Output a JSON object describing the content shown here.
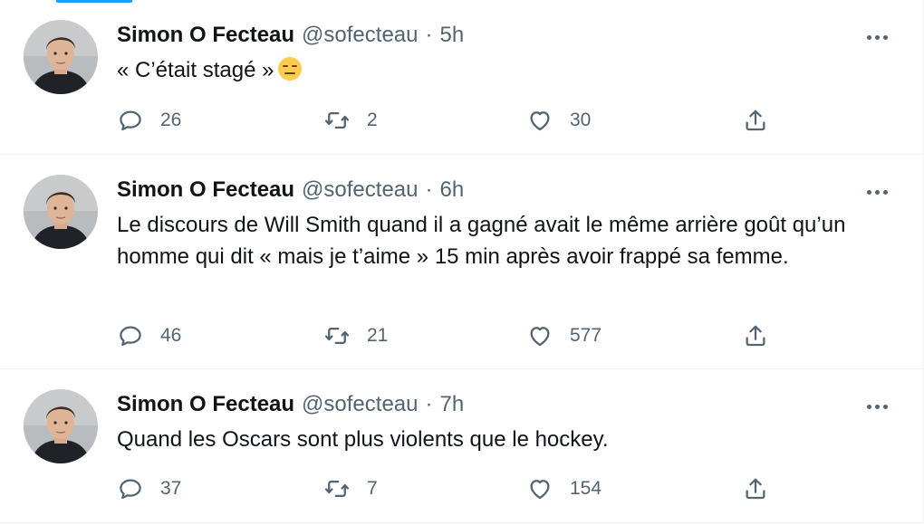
{
  "colors": {
    "accent": "#1d9bf0",
    "text": "#0f1419",
    "secondary": "#536471",
    "border": "#eff3f4"
  },
  "tweets": [
    {
      "display_name": "Simon O Fecteau",
      "handle": "@sofecteau",
      "separator": "·",
      "time": "5h",
      "text": "« C’était stagé »",
      "emoji": "expressionless-face-emoji",
      "replies": "26",
      "retweets": "2",
      "likes": "30"
    },
    {
      "display_name": "Simon O Fecteau",
      "handle": "@sofecteau",
      "separator": "·",
      "time": "6h",
      "text": "Le discours de Will Smith quand il a gagné avait le même arrière goût qu’un homme qui dit « mais je t’aime » 15 min après avoir frappé sa femme.",
      "replies": "46",
      "retweets": "21",
      "likes": "577"
    },
    {
      "display_name": "Simon O Fecteau",
      "handle": "@sofecteau",
      "separator": "·",
      "time": "7h",
      "text": "Quand les Oscars sont plus violents que le hockey.",
      "replies": "37",
      "retweets": "7",
      "likes": "154"
    }
  ]
}
